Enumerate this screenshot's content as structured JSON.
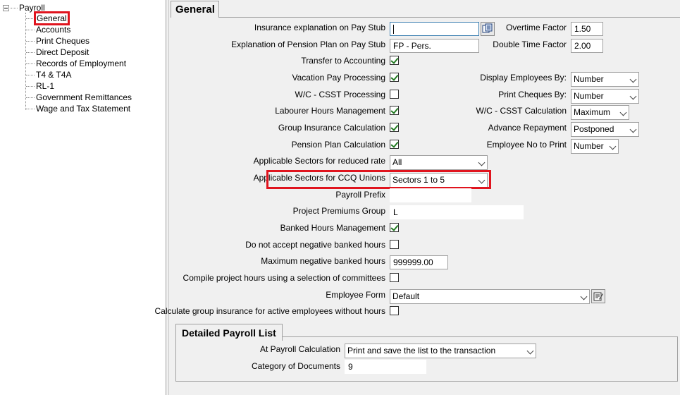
{
  "tree": {
    "root": "Payroll",
    "items": [
      {
        "label": "General"
      },
      {
        "label": "Accounts"
      },
      {
        "label": "Print Cheques"
      },
      {
        "label": "Direct Deposit"
      },
      {
        "label": "Records of Employment"
      },
      {
        "label": "T4 & T4A"
      },
      {
        "label": "RL-1"
      },
      {
        "label": "Government Remittances"
      },
      {
        "label": "Wage and Tax Statement"
      }
    ],
    "selected": "General"
  },
  "tab": {
    "label": "General"
  },
  "form": {
    "insurance_explanation": {
      "label": "Insurance explanation on Pay Stub",
      "value": ""
    },
    "pension_explanation": {
      "label": "Explanation of Pension Plan on Pay Stub",
      "value": "FP - Pers."
    },
    "transfer_accounting": {
      "label": "Transfer to Accounting",
      "checked": true
    },
    "vacation_pay": {
      "label": "Vacation Pay Processing",
      "checked": true
    },
    "wc_csst_processing": {
      "label": "W/C - CSST Processing",
      "checked": false
    },
    "labourer_hours": {
      "label": "Labourer Hours Management",
      "checked": true
    },
    "group_insurance": {
      "label": "Group Insurance Calculation",
      "checked": true
    },
    "pension_plan": {
      "label": "Pension Plan Calculation",
      "checked": true
    },
    "sectors_reduced": {
      "label": "Applicable Sectors for reduced rate",
      "value": "All"
    },
    "sectors_ccq": {
      "label": "Applicable Sectors for CCQ Unions",
      "value": "Sectors 1 to 5"
    },
    "payroll_prefix": {
      "label": "Payroll Prefix",
      "value": ""
    },
    "project_premiums": {
      "label": "Project Premiums Group",
      "value": "L"
    },
    "banked_hours": {
      "label": "Banked Hours Management",
      "checked": true
    },
    "no_negative_banked": {
      "label": "Do not accept negative banked hours",
      "checked": false
    },
    "max_negative_banked": {
      "label": "Maximum negative banked hours",
      "value": "999999.00"
    },
    "compile_committees": {
      "label": "Compile project hours using a selection of committees",
      "checked": false
    },
    "employee_form": {
      "label": "Employee Form",
      "value": "Default"
    },
    "group_ins_active": {
      "label": "Calculate group insurance for active employees without hours",
      "checked": false
    },
    "overtime_factor": {
      "label": "Overtime Factor",
      "value": "1.50"
    },
    "double_time_factor": {
      "label": "Double Time Factor",
      "value": "2.00"
    },
    "display_employees_by": {
      "label": "Display Employees By:",
      "value": "Number"
    },
    "print_cheques_by": {
      "label": "Print Cheques By:",
      "value": "Number"
    },
    "wc_csst_calc": {
      "label": "W/C - CSST Calculation",
      "value": "Maximum"
    },
    "advance_repayment": {
      "label": "Advance Repayment",
      "value": "Postponed"
    },
    "employee_no_print": {
      "label": "Employee No to Print",
      "value": "Number"
    }
  },
  "detailed_list": {
    "title": "Detailed Payroll List",
    "at_payroll_calc": {
      "label": "At Payroll Calculation",
      "value": "Print and save the list to the transaction"
    },
    "category_docs": {
      "label": "Category of Documents",
      "value": "9"
    }
  },
  "colors": {
    "highlight": "#e0141e",
    "check": "#217a21",
    "focus_border": "#3c7fb1"
  },
  "icons": {
    "lookup_button": "browse-icon",
    "form_button": "form-edit-icon"
  }
}
